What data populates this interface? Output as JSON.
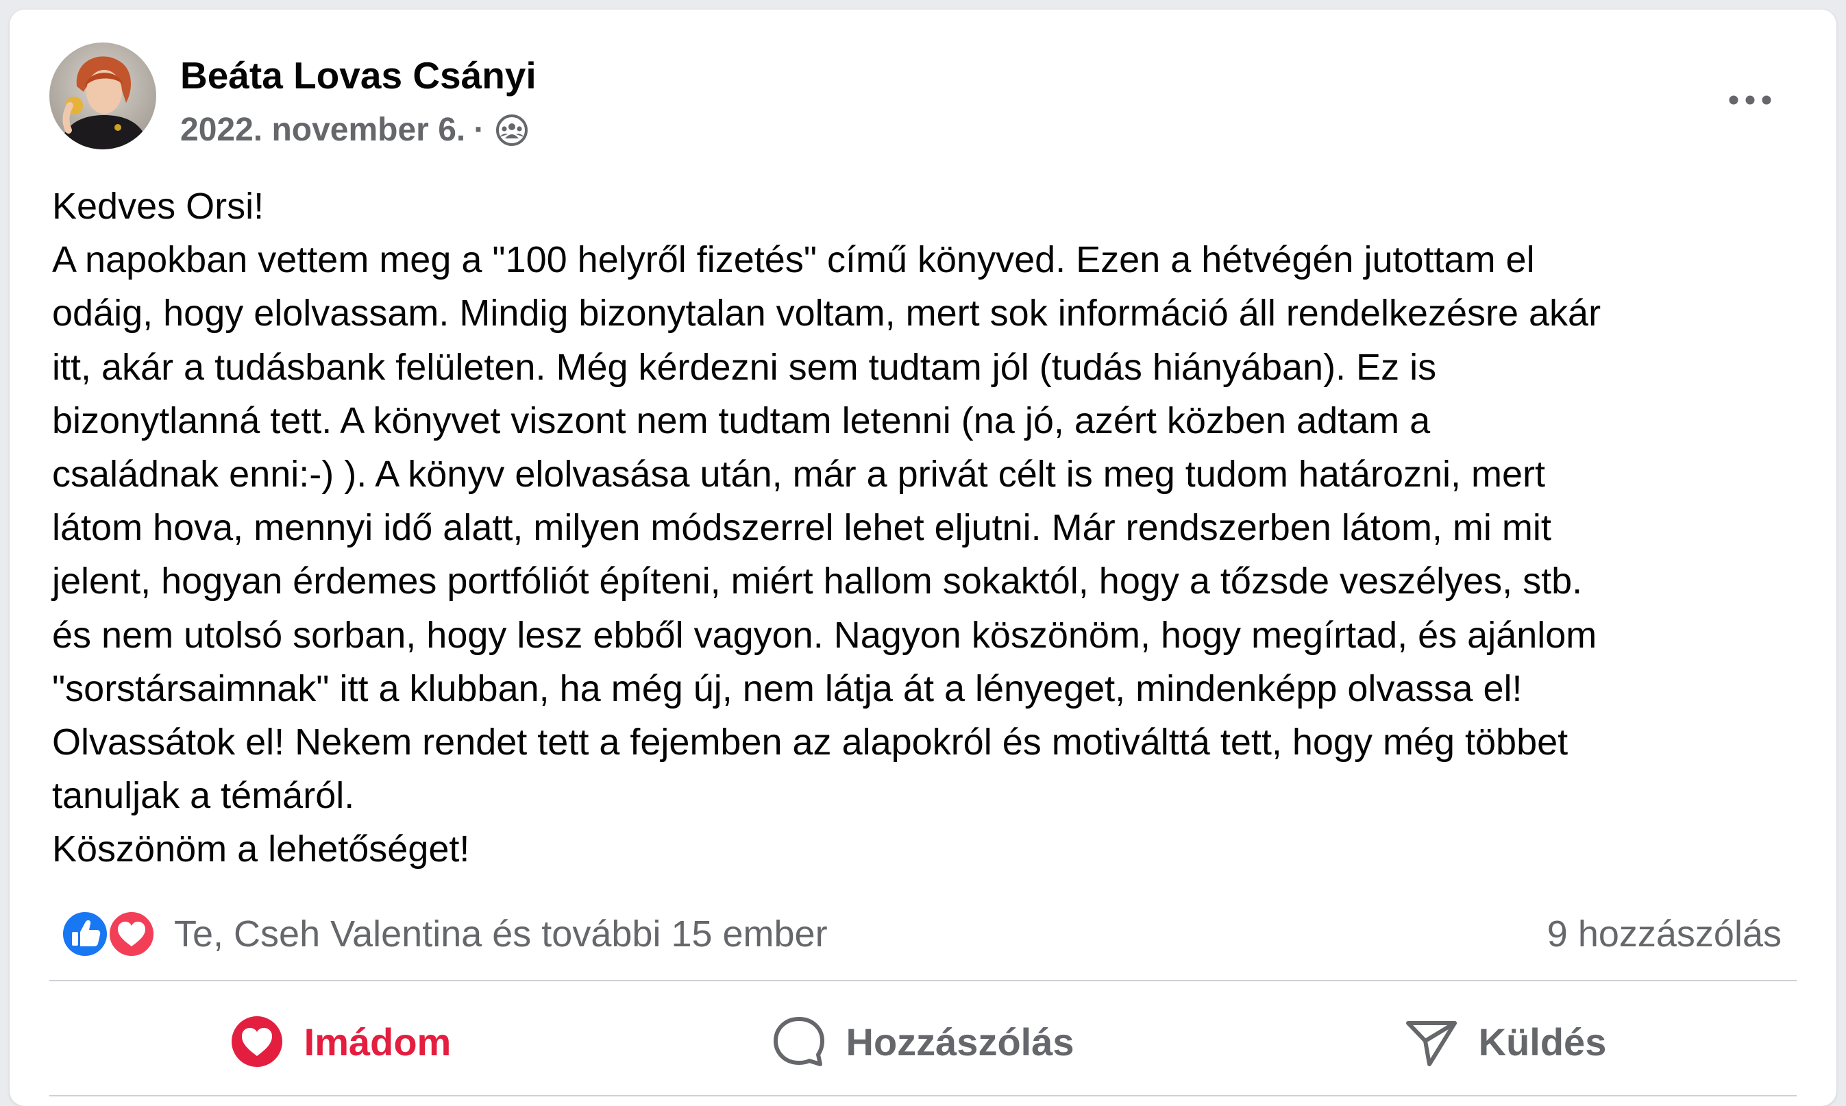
{
  "post": {
    "author": "Beáta Lovas Csányi",
    "date": "2022. november 6.",
    "separator": "·",
    "audience_icon": "group-icon",
    "more_icon": "more-options-icon",
    "lines": [
      "Kedves Orsi!",
      "A napokban vettem meg a \"100 helyről fizetés\" című könyved. Ezen a hétvégén jutottam el",
      "odáig, hogy elolvassam. Mindig bizonytalan voltam, mert sok információ áll rendelkezésre akár",
      "itt, akár a tudásbank felületen. Még kérdezni sem tudtam jól (tudás hiányában). Ez is",
      "bizonytlanná tett. A könyvet viszont nem tudtam letenni (na jó, azért közben adtam a",
      "családnak enni:-) ). A könyv elolvasása után, már a privát célt is meg tudom határozni, mert",
      "látom hova, mennyi idő alatt, milyen módszerrel lehet eljutni. Már rendszerben látom, mi mit",
      "jelent, hogyan érdemes portfóliót építeni, miért hallom sokaktól, hogy a tőzsde veszélyes, stb.",
      "és nem utolsó sorban, hogy lesz ebből vagyon. Nagyon köszönöm, hogy megírtad, és ajánlom",
      "\"sorstársaimnak\" itt a klubban, ha még új, nem látja át a lényeget, mindenképp olvassa el!",
      "Olvassátok el! Nekem rendet tett a fejemben az alapokról és motiválttá tett, hogy még többet",
      "tanuljak a témáról.",
      "Köszönöm a lehetőséget!"
    ]
  },
  "reactions": {
    "icons": [
      "like-icon",
      "love-icon"
    ],
    "text": "Te, Cseh Valentina és további 15 ember",
    "comments_count": "9 hozzászólás"
  },
  "actions": {
    "love_label": "Imádom",
    "comment_label": "Hozzászólás",
    "send_label": "Küldés"
  },
  "colors": {
    "love_red": "#e41e3f",
    "like_blue": "#1877f2",
    "text_primary": "#050505",
    "text_secondary": "#65676b"
  }
}
